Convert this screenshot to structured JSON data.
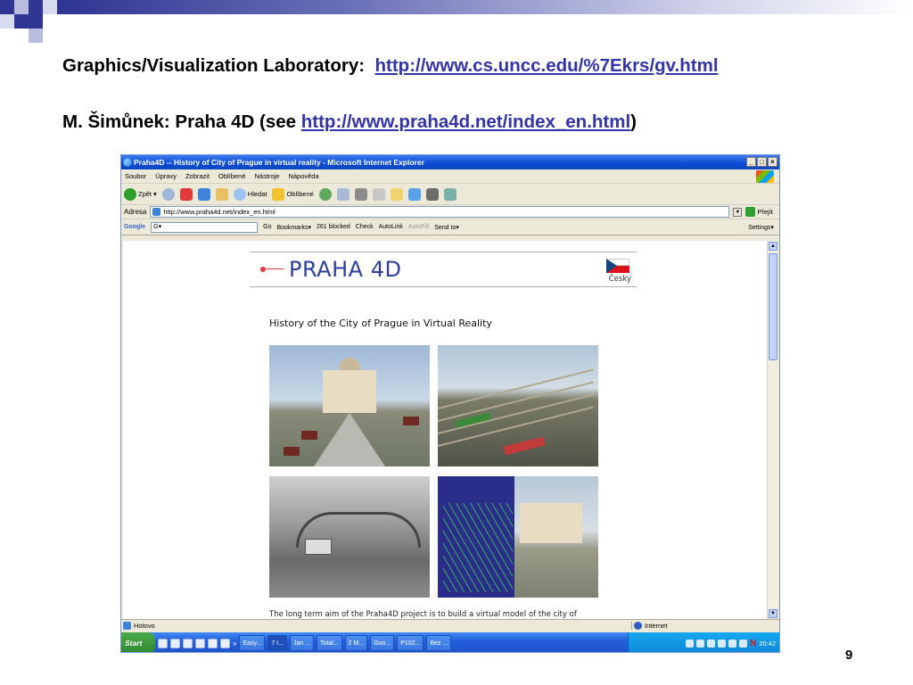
{
  "slide": {
    "line1_label": "Graphics/Visualization Laboratory:",
    "line1_link": "http://www.cs.uncc.edu/%7Ekrs/gv.html",
    "line2_label": "M. Šimůnek: Praha 4D   (see",
    "line2_link": "http://www.praha4d.net/index_en.html",
    "line2_close": ")",
    "page_number": "9"
  },
  "browser": {
    "title": "Praha4D -- History of City of Prague in virtual reality - Microsoft Internet Explorer",
    "menu": [
      "Soubor",
      "Úpravy",
      "Zobrazit",
      "Oblíbené",
      "Nástroje",
      "Nápověda"
    ],
    "toolbar": {
      "back": "Zpět",
      "search": "Hledat",
      "favorites": "Oblíbené"
    },
    "address_label": "Adresa",
    "address_value": "http://www.praha4d.net/index_en.html",
    "go_label": "Přejít",
    "google_bar": {
      "logo": "Google",
      "search_prefix": "G▾",
      "go": "Go",
      "bookmarks": "Bookmarks▾",
      "blocked": "261 blocked",
      "check": "Check",
      "autolink": "AutoLink",
      "autofill": "AutoFill",
      "send_to": "Send to▾",
      "settings": "Settings▾"
    },
    "status_left": "Hotovo",
    "status_right": "Internet"
  },
  "webpage": {
    "logo_text": "PRAHA 4D",
    "language_link": "Česky",
    "heading": "History of the City of Prague in Virtual Reality",
    "body_text": "The long term aim of the Praha4D project is to build a virtual model of the city of"
  },
  "taskbar": {
    "start": "Start",
    "tasks": [
      "Easy...",
      "7 I...",
      "Jan ...",
      "Total...",
      "2 M...",
      "Goo...",
      "P102...",
      "Bez ..."
    ],
    "clock": "20:42"
  },
  "colors": {
    "slide_accent": "#2e3592",
    "link": "#3333aa",
    "ie_title": "#0a4ad4",
    "praha_logo": "#2c3f9e"
  }
}
